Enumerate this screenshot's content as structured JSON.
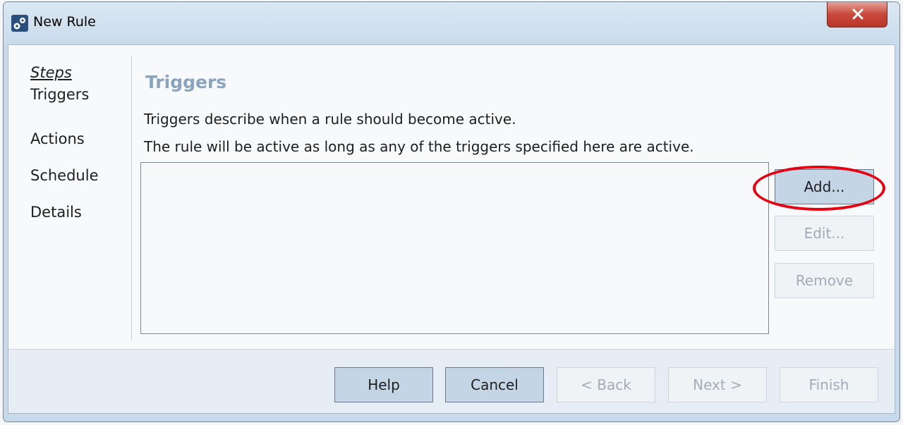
{
  "window": {
    "title": "New Rule",
    "close_label": "x"
  },
  "steps": {
    "header": "Steps",
    "items": [
      {
        "label": "Triggers"
      },
      {
        "label": "Actions"
      },
      {
        "label": "Schedule"
      },
      {
        "label": "Details"
      }
    ]
  },
  "page": {
    "heading": "Triggers",
    "description_line1": "Triggers describe when a rule should become active.",
    "description_line2": "The rule will be active as long as any of the triggers specified here are active."
  },
  "trigger_buttons": {
    "add": "Add...",
    "edit": "Edit...",
    "remove": "Remove"
  },
  "footer_buttons": {
    "help": "Help",
    "cancel": "Cancel",
    "back": "< Back",
    "next": "Next >",
    "finish": "Finish"
  },
  "colors": {
    "heading": "#8ba3bd",
    "highlight": "#e60012",
    "active_button": "#c4d5e5",
    "disabled_text": "#a3acb6"
  },
  "icons": {
    "app": "puzzle-gear-icon",
    "close": "close-icon"
  }
}
